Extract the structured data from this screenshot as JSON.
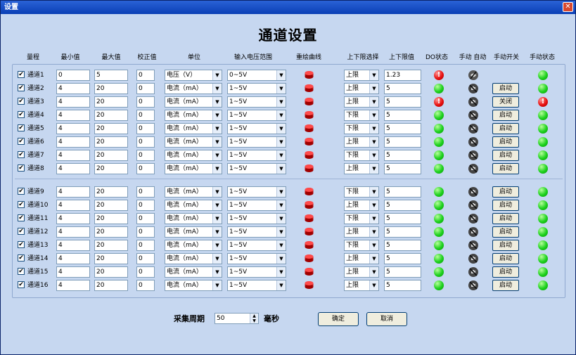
{
  "window": {
    "title": "设置",
    "heading": "通道设置",
    "close_glyph": "✕"
  },
  "headers": [
    "量程",
    "最小值",
    "最大值",
    "校正值",
    "单位",
    "输入电压范围",
    "重绘曲线",
    "上下限选择",
    "上下限值",
    "DO状态",
    "手动 自动",
    "手动开关",
    "手动状态"
  ],
  "checkbox_glyph": "✔",
  "channels": [
    {
      "name": "通道1",
      "min": "0",
      "max": "5",
      "calib": "0",
      "unit": "电压（V）",
      "range": "0~5V",
      "limit_sel": "上限",
      "limit_val": "1.23",
      "do": "alarm",
      "manual_icon": "alt",
      "switch": "",
      "state": "green"
    },
    {
      "name": "通道2",
      "min": "4",
      "max": "20",
      "calib": "0",
      "unit": "电流（mA）",
      "range": "1~5V",
      "limit_sel": "上限",
      "limit_val": "5",
      "do": "green",
      "manual_icon": "hand",
      "switch": "启动",
      "state": "green"
    },
    {
      "name": "通道3",
      "min": "4",
      "max": "20",
      "calib": "0",
      "unit": "电流（mA）",
      "range": "1~5V",
      "limit_sel": "上限",
      "limit_val": "5",
      "do": "alarm",
      "manual_icon": "hand",
      "switch": "关闭",
      "state": "alarm"
    },
    {
      "name": "通道4",
      "min": "4",
      "max": "20",
      "calib": "0",
      "unit": "电流（mA）",
      "range": "1~5V",
      "limit_sel": "下限",
      "limit_val": "5",
      "do": "green",
      "manual_icon": "hand",
      "switch": "启动",
      "state": "green"
    },
    {
      "name": "通道5",
      "min": "4",
      "max": "20",
      "calib": "0",
      "unit": "电流（mA）",
      "range": "1~5V",
      "limit_sel": "下限",
      "limit_val": "5",
      "do": "green",
      "manual_icon": "hand",
      "switch": "启动",
      "state": "green"
    },
    {
      "name": "通道6",
      "min": "4",
      "max": "20",
      "calib": "0",
      "unit": "电流（mA）",
      "range": "1~5V",
      "limit_sel": "上限",
      "limit_val": "5",
      "do": "green",
      "manual_icon": "hand",
      "switch": "启动",
      "state": "green"
    },
    {
      "name": "通道7",
      "min": "4",
      "max": "20",
      "calib": "0",
      "unit": "电流（mA）",
      "range": "1~5V",
      "limit_sel": "下限",
      "limit_val": "5",
      "do": "green",
      "manual_icon": "hand",
      "switch": "启动",
      "state": "green"
    },
    {
      "name": "通道8",
      "min": "4",
      "max": "20",
      "calib": "0",
      "unit": "电流（mA）",
      "range": "1~5V",
      "limit_sel": "上限",
      "limit_val": "5",
      "do": "green",
      "manual_icon": "hand",
      "switch": "启动",
      "state": "green"
    },
    {
      "name": "通道9",
      "min": "4",
      "max": "20",
      "calib": "0",
      "unit": "电流（mA）",
      "range": "1~5V",
      "limit_sel": "下限",
      "limit_val": "5",
      "do": "green",
      "manual_icon": "hand",
      "switch": "启动",
      "state": "green"
    },
    {
      "name": "通道10",
      "min": "4",
      "max": "20",
      "calib": "0",
      "unit": "电流（mA）",
      "range": "1~5V",
      "limit_sel": "上限",
      "limit_val": "5",
      "do": "green",
      "manual_icon": "hand",
      "switch": "启动",
      "state": "green"
    },
    {
      "name": "通道11",
      "min": "4",
      "max": "20",
      "calib": "0",
      "unit": "电流（mA）",
      "range": "1~5V",
      "limit_sel": "下限",
      "limit_val": "5",
      "do": "green",
      "manual_icon": "hand",
      "switch": "启动",
      "state": "green"
    },
    {
      "name": "通道12",
      "min": "4",
      "max": "20",
      "calib": "0",
      "unit": "电流（mA）",
      "range": "1~5V",
      "limit_sel": "上限",
      "limit_val": "5",
      "do": "green",
      "manual_icon": "hand",
      "switch": "启动",
      "state": "green"
    },
    {
      "name": "通道13",
      "min": "4",
      "max": "20",
      "calib": "0",
      "unit": "电流（mA）",
      "range": "1~5V",
      "limit_sel": "下限",
      "limit_val": "5",
      "do": "green",
      "manual_icon": "hand",
      "switch": "启动",
      "state": "green"
    },
    {
      "name": "通道14",
      "min": "4",
      "max": "20",
      "calib": "0",
      "unit": "电流（mA）",
      "range": "1~5V",
      "limit_sel": "上限",
      "limit_val": "5",
      "do": "green",
      "manual_icon": "hand",
      "switch": "启动",
      "state": "green"
    },
    {
      "name": "通道15",
      "min": "4",
      "max": "20",
      "calib": "0",
      "unit": "电流（mA）",
      "range": "1~5V",
      "limit_sel": "上限",
      "limit_val": "5",
      "do": "green",
      "manual_icon": "hand",
      "switch": "启动",
      "state": "green"
    },
    {
      "name": "通道16",
      "min": "4",
      "max": "20",
      "calib": "0",
      "unit": "电流（mA）",
      "range": "1~5V",
      "limit_sel": "上限",
      "limit_val": "5",
      "do": "green",
      "manual_icon": "hand",
      "switch": "启动",
      "state": "green"
    }
  ],
  "footer": {
    "period_label": "采集周期",
    "period_value": "50",
    "unit_label": "毫秒",
    "ok_label": "确定",
    "cancel_label": "取消"
  },
  "colors": {
    "window_bg": "#c6d7f0",
    "titlebar": "#0a3fb5",
    "led_green": "#1dd11d",
    "led_red": "#e81010"
  },
  "icons": {
    "close": "close-icon",
    "plot": "redraw-curve-icon",
    "manual": "manual-auto-icon",
    "alarm": "alarm-icon",
    "checkbox": "check-icon"
  }
}
